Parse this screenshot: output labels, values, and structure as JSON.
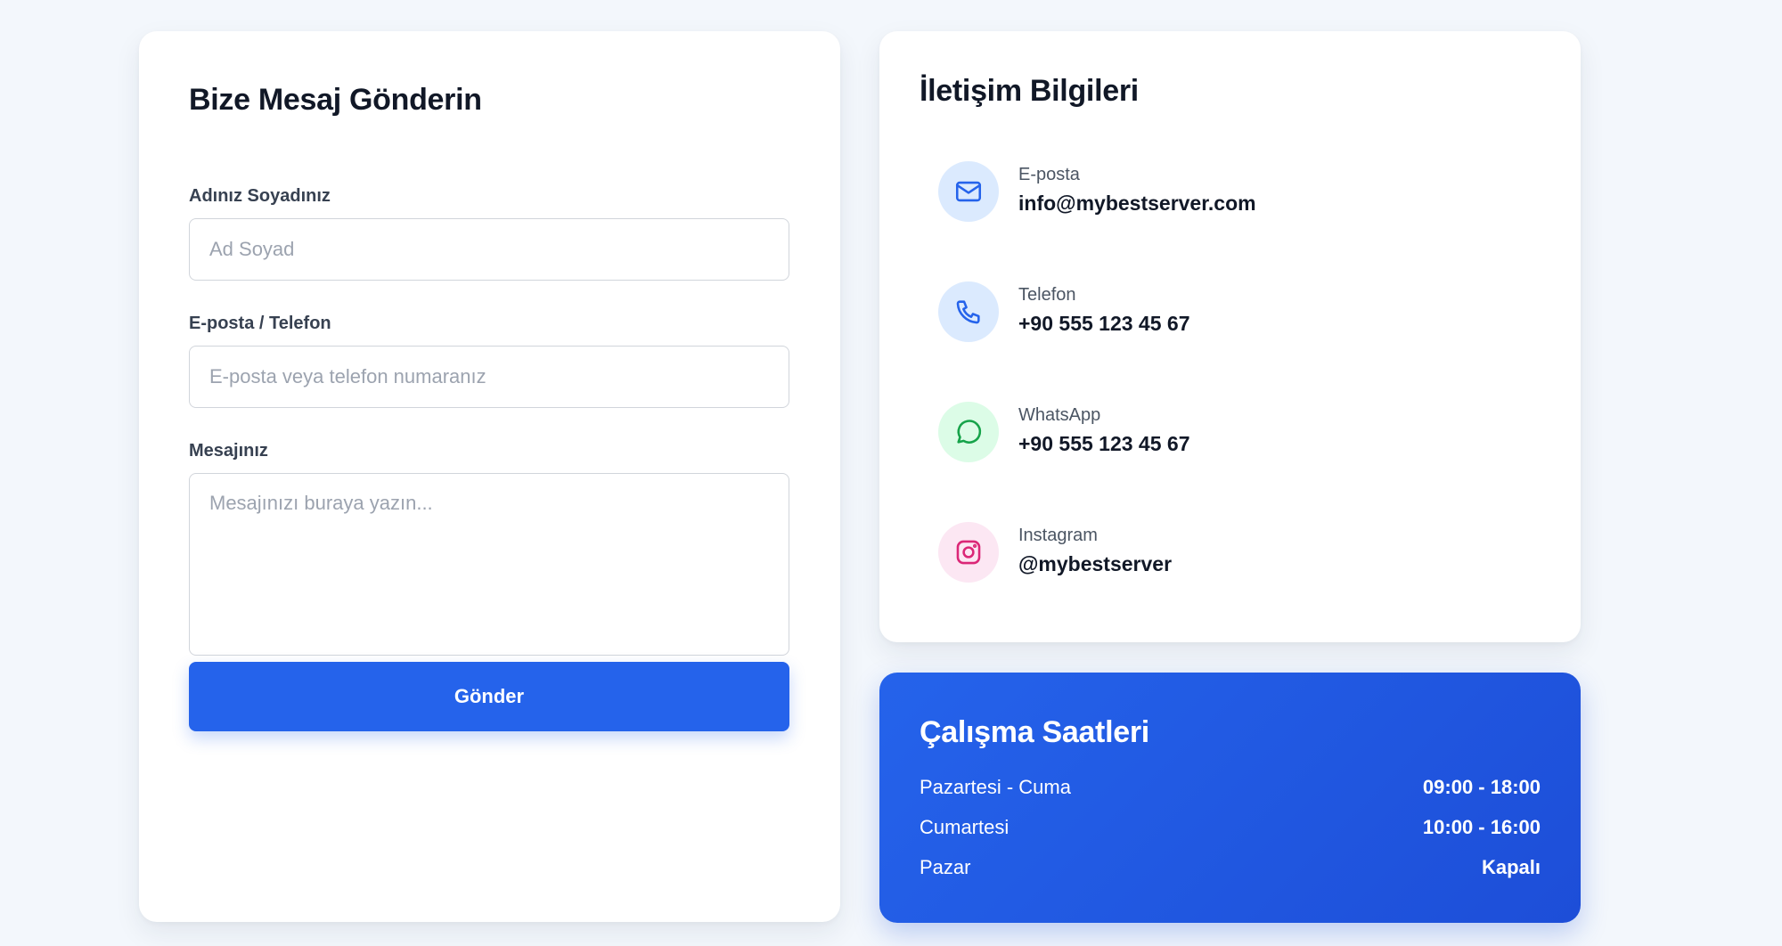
{
  "form": {
    "title": "Bize Mesaj Gönderin",
    "name_label": "Adınız Soyadınız",
    "name_placeholder": "Ad Soyad",
    "contact_label": "E-posta / Telefon",
    "contact_placeholder": "E-posta veya telefon numaranız",
    "message_label": "Mesajınız",
    "message_placeholder": "Mesajınızı buraya yazın...",
    "submit_label": "Gönder"
  },
  "contact": {
    "title": "İletişim Bilgileri",
    "items": [
      {
        "icon": "mail-icon",
        "label": "E-posta",
        "value": "info@mybestserver.com",
        "color": "#2563eb",
        "bg": "#dbeafe"
      },
      {
        "icon": "phone-icon",
        "label": "Telefon",
        "value": "+90 555 123 45 67",
        "color": "#2563eb",
        "bg": "#dbeafe"
      },
      {
        "icon": "whatsapp-icon",
        "label": "WhatsApp",
        "value": "+90 555 123 45 67",
        "color": "#16a34a",
        "bg": "#dcfce7"
      },
      {
        "icon": "instagram-icon",
        "label": "Instagram",
        "value": "@mybestserver",
        "color": "#db2777",
        "bg": "#fce7f3"
      }
    ]
  },
  "hours": {
    "title": "Çalışma Saatleri",
    "rows": [
      {
        "day": "Pazartesi - Cuma",
        "time": "09:00 - 18:00"
      },
      {
        "day": "Cumartesi",
        "time": "10:00 - 16:00"
      },
      {
        "day": "Pazar",
        "time": "Kapalı"
      }
    ]
  },
  "colors": {
    "primary": "#2563eb",
    "background": "#f3f7fc"
  }
}
